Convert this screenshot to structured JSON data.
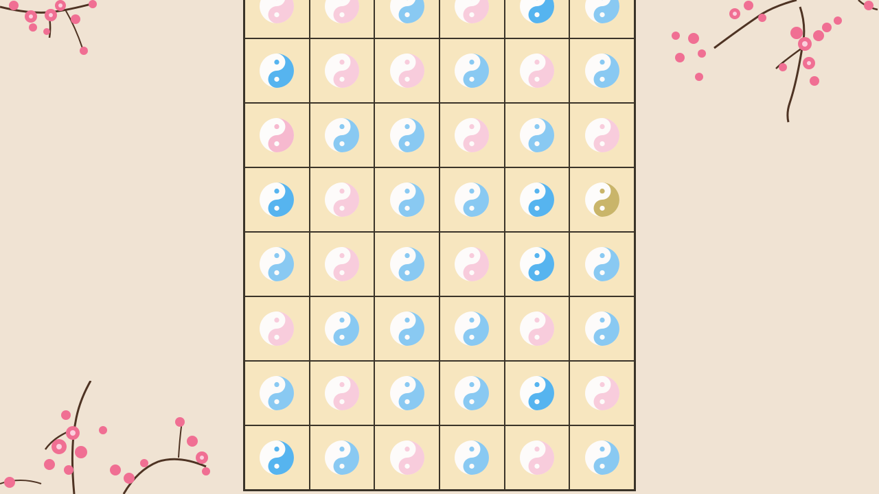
{
  "game": {
    "colors": {
      "background": "#f0e3d3",
      "board": "#f7e6bf",
      "grid_line": "#3a3328",
      "blue": "#56b4ef",
      "pink": "#f6b9cf",
      "gold": "#c9b56a",
      "white": "#fdfcfb",
      "blossom": "#f06f93",
      "branch": "#4e3323"
    },
    "board": {
      "rows": [
        [
          "pink-faded",
          "pink-faded",
          "blue-faded",
          "pink-faded",
          "blue",
          "blue-faded"
        ],
        [
          "blue",
          "pink-faded",
          "pink-faded",
          "blue-faded",
          "pink-faded",
          "blue-faded"
        ],
        [
          "pink",
          "blue-faded",
          "blue-faded",
          "pink-faded",
          "blue-faded",
          "pink-faded"
        ],
        [
          "blue",
          "pink-faded",
          "blue-faded",
          "blue-faded",
          "blue",
          "gold"
        ],
        [
          "blue-faded",
          "pink-faded",
          "blue-faded",
          "pink-faded",
          "blue",
          "blue-faded"
        ],
        [
          "pink-faded",
          "blue-faded",
          "blue-faded",
          "blue-faded",
          "pink-faded",
          "blue-faded"
        ],
        [
          "blue-faded",
          "pink-faded",
          "blue-faded",
          "blue-faded",
          "blue",
          "pink-faded"
        ],
        [
          "blue",
          "blue-faded",
          "pink-faded",
          "blue-faded",
          "pink-faded",
          "blue-faded"
        ]
      ]
    },
    "decorations": [
      {
        "name": "cherry-blossom-top-left-icon"
      },
      {
        "name": "cherry-blossom-top-right-icon"
      },
      {
        "name": "cherry-blossom-bottom-left-icon"
      }
    ]
  }
}
